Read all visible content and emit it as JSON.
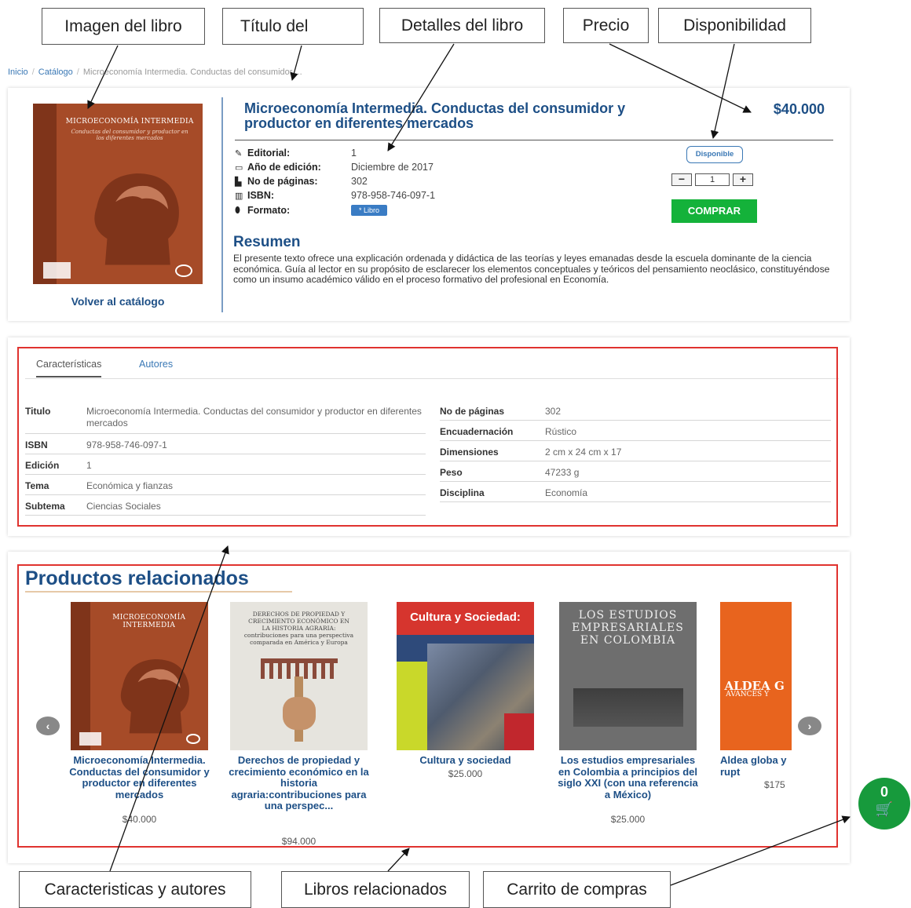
{
  "callouts": {
    "book_image": "Imagen del libro",
    "book_title": "Título del",
    "book_details": "Detalles del libro",
    "price": "Precio",
    "availability": "Disponibilidad",
    "features_authors": "Caracteristicas y autores",
    "related_books": "Libros relacionados",
    "cart": "Carrito de compras"
  },
  "breadcrumb": {
    "home": "Inicio",
    "catalog": "Catálogo",
    "current": "Microeconomía Intermedia. Conductas del consumidor ..."
  },
  "book": {
    "title": "Microeconomía Intermedia. Conductas del consumidor y productor en diferentes mercados",
    "price": "$40.000",
    "back_link": "Volver al catálogo",
    "cover_title": "MICROECONOMÍA INTERMEDIA",
    "cover_subtitle": "Conductas del consumidor y productor en los diferentes mercados",
    "details": [
      {
        "icon": "pencil-icon",
        "glyph": "✎",
        "label": "Editorial:",
        "value": "1"
      },
      {
        "icon": "calendar-icon",
        "glyph": "▭",
        "label": "Año de edición:",
        "value": "Diciembre de 2017"
      },
      {
        "icon": "file-icon",
        "glyph": "▙",
        "label": "No de páginas:",
        "value": "302"
      },
      {
        "icon": "barcode-icon",
        "glyph": "▥",
        "label": "ISBN:",
        "value": "978-958-746-097-1"
      }
    ],
    "format": {
      "icon": "tags-icon",
      "glyph": "⬮",
      "label": "Formato:",
      "value": "* Libro"
    },
    "availability": "Disponible",
    "quantity": "1",
    "qty_minus": "−",
    "qty_plus": "+",
    "buy": "COMPRAR",
    "summary_title": "Resumen",
    "summary": "El presente texto ofrece una explicación ordenada y didáctica de las teorías y leyes emanadas desde la escuela dominante de la ciencia económica. Guía al lector en su propósito de esclarecer los elementos conceptuales y teóricos del pensamiento neoclásico, constituyéndose como un insumo académico válido en el proceso formativo del profesional en Economía."
  },
  "tabs": {
    "characteristics": "Características",
    "authors": "Autores"
  },
  "specs_left": [
    {
      "key": "Titulo",
      "value": "Microeconomía Intermedia. Conductas del consumidor y productor en diferentes mercados"
    },
    {
      "key": "ISBN",
      "value": "978-958-746-097-1"
    },
    {
      "key": "Edición",
      "value": "1"
    },
    {
      "key": "Tema",
      "value": "Económica y fianzas"
    },
    {
      "key": "Subtema",
      "value": "Ciencias Sociales"
    }
  ],
  "specs_right": [
    {
      "key": "No de páginas",
      "value": "302"
    },
    {
      "key": "Encuadernación",
      "value": "Rústico"
    },
    {
      "key": "Dimensiones",
      "value": "2 cm x 24 cm x 17"
    },
    {
      "key": "Peso",
      "value": "47233 g"
    },
    {
      "key": "Disciplina",
      "value": "Economía"
    }
  ],
  "related": {
    "title": "Productos relacionados",
    "prev": "‹",
    "next": "›",
    "items": [
      {
        "name": "Microeconomía Intermedia. Conductas del consumidor y productor en diferentes mercados",
        "price": "$40.000"
      },
      {
        "name": "Derechos de propiedad y crecimiento económico en la historia agraria:contribuciones para una perspec...",
        "price": "$94.000"
      },
      {
        "name": "Cultura y sociedad",
        "price": "$25.000"
      },
      {
        "name": "Los estudios empresariales en Colombia a principios del siglo XXI (con una referencia a México)",
        "price": "$25.000"
      },
      {
        "name": "Aldea globa y rupt",
        "price": "$175"
      }
    ],
    "covers": {
      "c1_title": "MICROECONOMÍA INTERMEDIA",
      "c2_title": "DERECHOS DE PROPIEDAD Y CRECIMIENTO ECONÓMICO EN LA HISTORIA AGRARIA: contribuciones para una perspectiva comparada en América y Europa",
      "c3_title": "Cultura y Sociedad:",
      "c4_title": "LOS ESTUDIOS EMPRESARIALES EN COLOMBIA",
      "c5_title": "ALDEA G",
      "c5_sub": "AVANCES Y"
    }
  },
  "cart": {
    "count": "0",
    "icon": "cart-icon"
  },
  "colors": {
    "accent": "#1d4f86",
    "buy": "#14b23a",
    "frame": "#e0332f",
    "cart": "#179a3c"
  }
}
